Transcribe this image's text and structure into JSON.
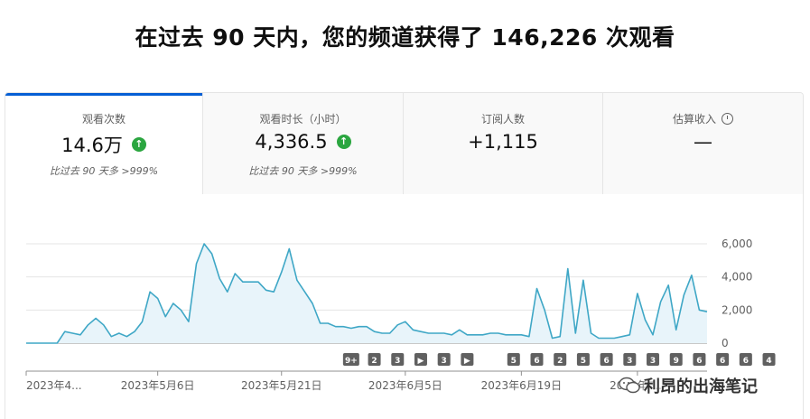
{
  "header": {
    "title": "在过去 90 天内，您的频道获得了 146,226 次观看"
  },
  "tabs": [
    {
      "label": "观看次数",
      "value": "14.6万",
      "compare": "比过去 90 天多 >999%",
      "trend_icon": "arrow-up-icon"
    },
    {
      "label": "观看时长（小时）",
      "value": "4,336.5",
      "compare": "比过去 90 天多 >999%",
      "trend_icon": "arrow-up-icon"
    },
    {
      "label": "订阅人数",
      "value": "+1,115",
      "compare": ""
    },
    {
      "label": "估算收入",
      "value": "—",
      "compare": "",
      "info_icon": "clock-icon"
    }
  ],
  "watermark": "利昂的出海笔记",
  "colors": {
    "accent": "#065fd4",
    "line": "#3fa7c6",
    "fill": "#e8f4fa",
    "badge": "#606060",
    "up": "#2ba640"
  },
  "chart_data": {
    "type": "area",
    "ylim": [
      0,
      6000
    ],
    "y_ticks": [
      "6,000",
      "4,000",
      "2,000",
      "0"
    ],
    "y_tick_values": [
      6000,
      4000,
      2000,
      0
    ],
    "x_tick_labels": [
      "2023年4...",
      "2023年5月6日",
      "2023年5月21日",
      "2023年6月5日",
      "2023年6月19日",
      "2023年7..."
    ],
    "x_tick_index": [
      0,
      17,
      33,
      49,
      64,
      79
    ],
    "series": [
      {
        "values": [
          0,
          0,
          0,
          0,
          0,
          700,
          600,
          500,
          1100,
          1500,
          1100,
          400,
          600,
          400,
          700,
          1300,
          3100,
          2700,
          1600,
          2400,
          2000,
          1300,
          4800,
          6000,
          5400,
          3900,
          3100,
          4200,
          3700,
          3700,
          3700,
          3200,
          3100,
          4300,
          5700,
          3800,
          3100,
          2400,
          1200,
          1200,
          1000,
          1000,
          900,
          1000,
          1000,
          700,
          600,
          600,
          1100,
          1300,
          800,
          700,
          600,
          600,
          600,
          500,
          800,
          500,
          500,
          500,
          600,
          600,
          500,
          500,
          500,
          400,
          3300,
          2000,
          300,
          400,
          4500,
          600,
          3800,
          600,
          300,
          300,
          300,
          400,
          500,
          3000,
          1400,
          500,
          2500,
          3500,
          800,
          2900,
          4100,
          2000,
          1900
        ]
      }
    ],
    "event_markers": [
      "9+",
      "2",
      "3",
      "▶",
      "3",
      "▶",
      "5",
      "6",
      "2",
      "5",
      "6",
      "3",
      "3",
      "9",
      "6",
      "6",
      "6",
      "4"
    ],
    "event_marker_index": [
      42,
      45,
      48,
      51,
      54,
      57,
      63,
      66,
      69,
      72,
      75,
      78,
      81,
      84,
      87,
      90,
      93,
      96
    ]
  }
}
